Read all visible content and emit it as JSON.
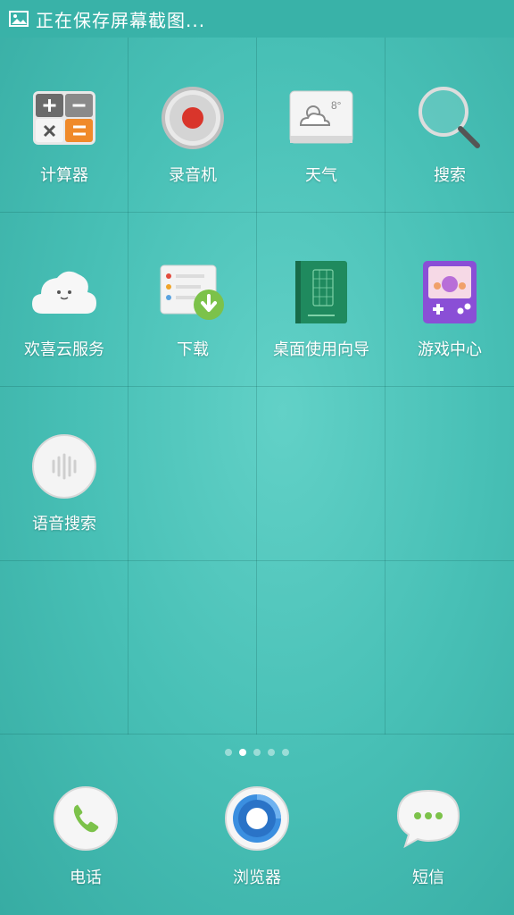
{
  "statusbar": {
    "text": "正在保存屏幕截图...",
    "icon": "image-icon"
  },
  "apps": [
    {
      "label": "计算器",
      "icon": "calculator-icon"
    },
    {
      "label": "录音机",
      "icon": "recorder-icon"
    },
    {
      "label": "天气",
      "icon": "weather-icon",
      "temp": "8°"
    },
    {
      "label": "搜索",
      "icon": "magnifier-icon"
    },
    {
      "label": "欢喜云服务",
      "icon": "cloud-icon"
    },
    {
      "label": "下载",
      "icon": "download-icon"
    },
    {
      "label": "桌面使用向导",
      "icon": "guide-book-icon"
    },
    {
      "label": "游戏中心",
      "icon": "game-console-icon"
    },
    {
      "label": "语音搜索",
      "icon": "voice-search-icon"
    }
  ],
  "page_indicator": {
    "count": 5,
    "active_index": 1
  },
  "dock": [
    {
      "label": "电话",
      "icon": "phone-icon"
    },
    {
      "label": "浏览器",
      "icon": "browser-icon"
    },
    {
      "label": "短信",
      "icon": "message-icon"
    }
  ],
  "colors": {
    "background": "#48c0b6",
    "statusbar": "#39b2a8",
    "accent_red": "#d9352b",
    "accent_green": "#7cc24a",
    "accent_orange": "#f08a2a"
  }
}
